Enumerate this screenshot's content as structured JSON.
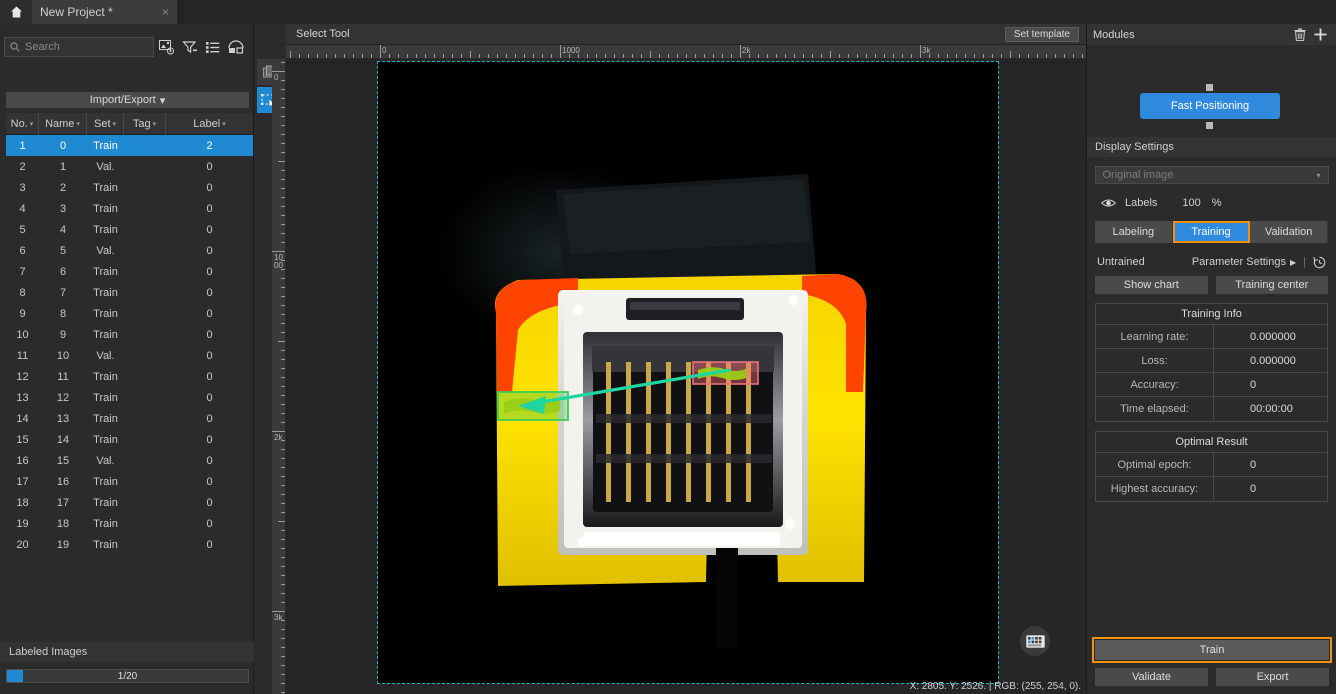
{
  "titlebar": {
    "home_icon": "home-icon",
    "tab_label": "New Project *",
    "tab_close": "×"
  },
  "sidebar": {
    "search": {
      "placeholder": "Search",
      "value": "",
      "icon": "search-icon"
    },
    "toolbar_icons": [
      "image-settings-icon",
      "filter-icon",
      "list-view-icon",
      "layout-icon"
    ],
    "import_export": "Import/Export",
    "import_export_caret": "▾",
    "columns": [
      {
        "label": "No.",
        "key": "no"
      },
      {
        "label": "Name",
        "key": "name"
      },
      {
        "label": "Set",
        "key": "set"
      },
      {
        "label": "Tag",
        "key": "tag"
      },
      {
        "label": "Label",
        "key": "label"
      }
    ],
    "sort_caret": "▾",
    "rows": [
      {
        "no": "1",
        "name": "0",
        "set": "Train",
        "tag": "",
        "label": "2",
        "selected": true
      },
      {
        "no": "2",
        "name": "1",
        "set": "Val.",
        "tag": "",
        "label": "0"
      },
      {
        "no": "3",
        "name": "2",
        "set": "Train",
        "tag": "",
        "label": "0"
      },
      {
        "no": "4",
        "name": "3",
        "set": "Train",
        "tag": "",
        "label": "0"
      },
      {
        "no": "5",
        "name": "4",
        "set": "Train",
        "tag": "",
        "label": "0"
      },
      {
        "no": "6",
        "name": "5",
        "set": "Val.",
        "tag": "",
        "label": "0"
      },
      {
        "no": "7",
        "name": "6",
        "set": "Train",
        "tag": "",
        "label": "0"
      },
      {
        "no": "8",
        "name": "7",
        "set": "Train",
        "tag": "",
        "label": "0"
      },
      {
        "no": "9",
        "name": "8",
        "set": "Train",
        "tag": "",
        "label": "0"
      },
      {
        "no": "10",
        "name": "9",
        "set": "Train",
        "tag": "",
        "label": "0"
      },
      {
        "no": "11",
        "name": "10",
        "set": "Val.",
        "tag": "",
        "label": "0"
      },
      {
        "no": "12",
        "name": "11",
        "set": "Train",
        "tag": "",
        "label": "0"
      },
      {
        "no": "13",
        "name": "12",
        "set": "Train",
        "tag": "",
        "label": "0"
      },
      {
        "no": "14",
        "name": "13",
        "set": "Train",
        "tag": "",
        "label": "0"
      },
      {
        "no": "15",
        "name": "14",
        "set": "Train",
        "tag": "",
        "label": "0"
      },
      {
        "no": "16",
        "name": "15",
        "set": "Val.",
        "tag": "",
        "label": "0"
      },
      {
        "no": "17",
        "name": "16",
        "set": "Train",
        "tag": "",
        "label": "0"
      },
      {
        "no": "18",
        "name": "17",
        "set": "Train",
        "tag": "",
        "label": "0"
      },
      {
        "no": "19",
        "name": "18",
        "set": "Train",
        "tag": "",
        "label": "0"
      },
      {
        "no": "20",
        "name": "19",
        "set": "Train",
        "tag": "",
        "label": "0"
      }
    ],
    "labeled_images_title": "Labeled Images",
    "progress_text": "1/20",
    "progress_percent": 5
  },
  "toolstrip": {
    "items": [
      {
        "icon": "layers-icon",
        "active": false
      },
      {
        "icon": "select-tool-icon",
        "active": true
      }
    ]
  },
  "canvas": {
    "tool_label": "Select Tool",
    "set_template": "Set template",
    "ruler_h_labels": [
      "0",
      "1000",
      "2k",
      "3k"
    ],
    "ruler_v_labels": [
      "0",
      "1000",
      "2k",
      "3k"
    ],
    "status": "X: 2805. Y: 2526. | RGB: (255, 254, 0).",
    "keyboard_icon": "keyboard-icon",
    "annotations": {
      "source_box_color": "#3fcc55",
      "target_box_color": "#e8737a",
      "arrow_color": "#1fd6a0"
    }
  },
  "right_panel": {
    "modules_title": "Modules",
    "delete_icon": "trash-icon",
    "add_icon": "plus-icon",
    "module_node": "Fast Positioning",
    "display_settings_title": "Display Settings",
    "image_select_value": "Original image",
    "select_caret": "▾",
    "labels_eye_icon": "eye-icon",
    "labels_label": "Labels",
    "labels_value": "100",
    "labels_unit": "%",
    "tabs": [
      {
        "label": "Labeling",
        "active": false
      },
      {
        "label": "Training",
        "active": true
      },
      {
        "label": "Validation",
        "active": false
      }
    ],
    "train_status": "Untrained",
    "parameter_settings": "Parameter Settings",
    "parameter_caret": "▶",
    "history_icon": "history-icon",
    "show_chart": "Show chart",
    "training_center": "Training center",
    "training_info": {
      "title": "Training Info",
      "rows": [
        {
          "key": "Learning rate:",
          "value": "0.000000"
        },
        {
          "key": "Loss:",
          "value": "0.000000"
        },
        {
          "key": "Accuracy:",
          "value": "0"
        },
        {
          "key": "Time elapsed:",
          "value": "00:00:00"
        }
      ]
    },
    "optimal_result": {
      "title": "Optimal Result",
      "rows": [
        {
          "key": "Optimal epoch:",
          "value": "0"
        },
        {
          "key": "Highest accuracy:",
          "value": "0"
        }
      ]
    },
    "train_button": "Train",
    "validate_button": "Validate",
    "export_button": "Export"
  },
  "colors": {
    "accent_blue": "#2f89dd",
    "highlight_orange": "#f0920f",
    "panel_bg": "#2b2b2b",
    "header_bg": "#333335"
  }
}
